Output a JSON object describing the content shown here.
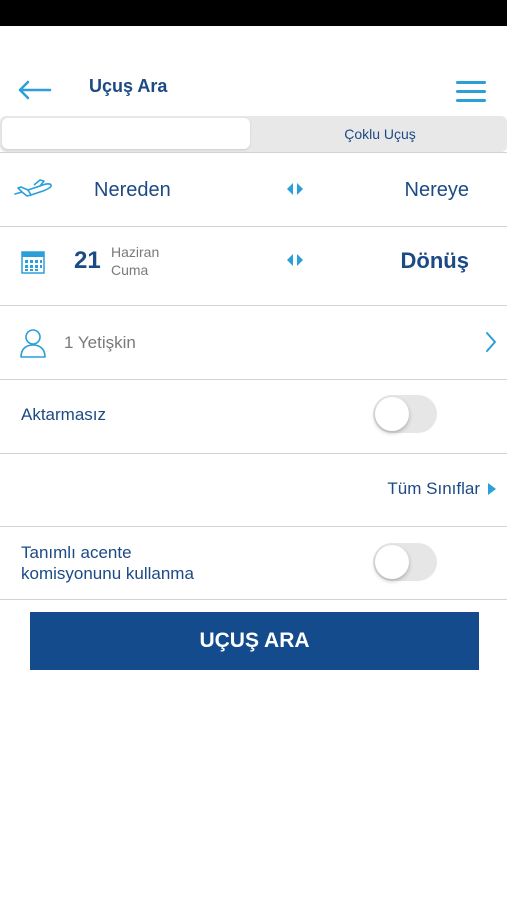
{
  "header": {
    "title": "Uçuş Ara",
    "back_icon": "arrow-left-icon",
    "menu_icon": "hamburger-menu-icon"
  },
  "tabs": [
    {
      "label": "",
      "active": true
    },
    {
      "label": "Çoklu Uçuş",
      "active": false
    }
  ],
  "route": {
    "from_label": "Nereden",
    "to_label": "Nereye",
    "plane_icon": "plane-icon",
    "swap_icon": "swap-arrows-icon"
  },
  "dates": {
    "departure_day": "21",
    "departure_month": "Haziran",
    "departure_weekday": "Cuma",
    "return_label": "Dönüş",
    "calendar_icon": "calendar-icon",
    "swap_icon": "swap-arrows-icon"
  },
  "passengers": {
    "label": "1 Yetişkin",
    "icon": "person-icon"
  },
  "options": {
    "direct_label": "Aktarmasız",
    "direct_enabled": false,
    "cabin_class_label": "Tüm Sınıflar",
    "commission_label_line1": "Tanımlı acente",
    "commission_label_line2": "komisyonunu kullanma",
    "commission_enabled": false
  },
  "actions": {
    "search_label": "UÇUŞ ARA"
  },
  "colors": {
    "primary": "#134b8d",
    "accent_icon": "#2a9fd8",
    "text_dark": "#1c4a84",
    "text_muted": "#7a7a7a",
    "divider": "#d3d3d3",
    "toggle_off": "#e6e6e6"
  }
}
